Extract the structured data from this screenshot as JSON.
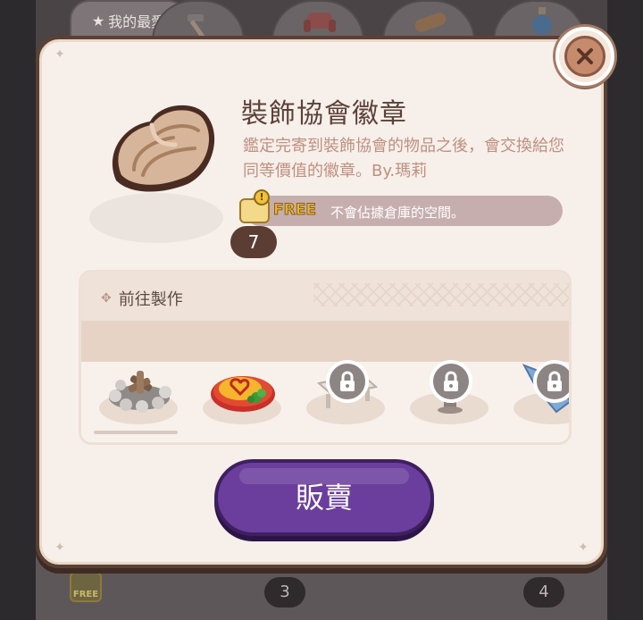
{
  "background": {
    "favorites_tab_label": "我的最愛",
    "free_tag": "FREE",
    "counts": [
      "3",
      "4"
    ]
  },
  "modal": {
    "item": {
      "name": "裝飾協會徽章",
      "description": "鑑定完寄到裝飾協會的物品之後，會交換給您同等價值的徽章。By.瑪莉",
      "count": "7",
      "icon": "shell-badge-icon"
    },
    "free_notice": {
      "tag": "FREE",
      "text": "不會佔據倉庫的空間。"
    },
    "craft": {
      "label": "前往製作",
      "items": [
        {
          "name": "campfire",
          "locked": false
        },
        {
          "name": "omelette-rice",
          "locked": false
        },
        {
          "name": "bench",
          "locked": true
        },
        {
          "name": "lantern",
          "locked": true
        },
        {
          "name": "crystal",
          "locked": true
        }
      ]
    },
    "sell_button_label": "販賣",
    "colors": {
      "accent": "#6b3e9e",
      "title": "#5d4138",
      "description": "#bf8f80",
      "free_bar": "#c7aeae"
    }
  }
}
